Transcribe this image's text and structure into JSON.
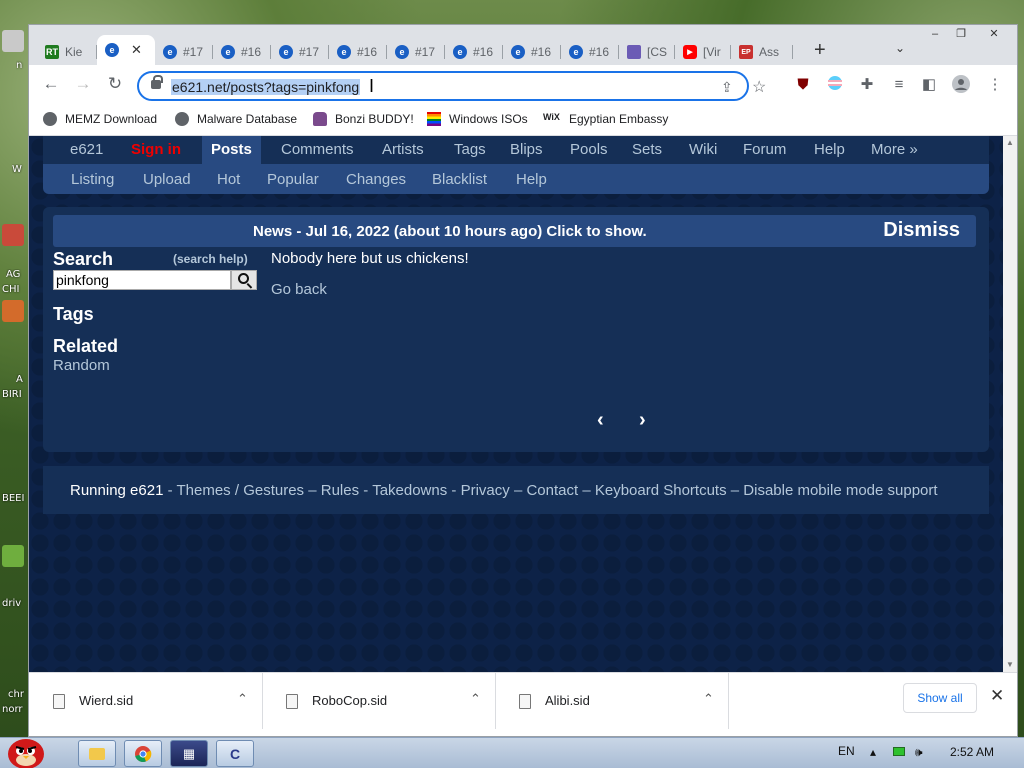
{
  "tabs": [
    {
      "label": "Kie",
      "favicon": "RT",
      "color": "#1f7a1f"
    },
    {
      "label": "",
      "favicon": "e",
      "color": "#1a5fc4",
      "active": true
    },
    {
      "label": "#17",
      "favicon": "e",
      "color": "#1a5fc4"
    },
    {
      "label": "#16",
      "favicon": "e",
      "color": "#1a5fc4"
    },
    {
      "label": "#17",
      "favicon": "e",
      "color": "#1a5fc4"
    },
    {
      "label": "#16",
      "favicon": "e",
      "color": "#1a5fc4"
    },
    {
      "label": "#17",
      "favicon": "e",
      "color": "#1a5fc4"
    },
    {
      "label": "#16",
      "favicon": "e",
      "color": "#1a5fc4"
    },
    {
      "label": "#16",
      "favicon": "e",
      "color": "#1a5fc4"
    },
    {
      "label": "#16",
      "favicon": "e",
      "color": "#1a5fc4"
    },
    {
      "label": "[CS",
      "favicon": "",
      "color": "#6b5bb5"
    },
    {
      "label": "[Vir",
      "favicon": "▶",
      "color": "#ff0000"
    },
    {
      "label": "Ass",
      "favicon": "EP",
      "color": "#c8302f"
    }
  ],
  "address_bar": {
    "url": "e621.net/posts?tags=pinkfong"
  },
  "bookmarks": [
    {
      "label": "MEMZ Download",
      "icon": "globe-icon"
    },
    {
      "label": "Malware Database",
      "icon": "globe-icon"
    },
    {
      "label": "Bonzi BUDDY!",
      "icon": "bonzi-icon"
    },
    {
      "label": "Windows ISOs",
      "icon": "windows-flag-icon"
    },
    {
      "label": "Egyptian Embassy",
      "icon": "wix-icon"
    }
  ],
  "site_nav": {
    "items": [
      "e621",
      "Sign in",
      "Posts",
      "Comments",
      "Artists",
      "Tags",
      "Blips",
      "Pools",
      "Sets",
      "Wiki",
      "Forum",
      "Help",
      "More »"
    ],
    "active": "Posts"
  },
  "sub_nav": {
    "items": [
      "Listing",
      "Upload",
      "Hot",
      "Popular",
      "Changes",
      "Blacklist",
      "Help"
    ]
  },
  "news": {
    "text": "News - Jul 16, 2022 (about 10 hours ago) Click to show.",
    "dismiss": "Dismiss"
  },
  "sidebar": {
    "search_title": "Search",
    "search_help": "(search help)",
    "search_value": "pinkfong",
    "tags_title": "Tags",
    "related_title": "Related",
    "related_link": "Random"
  },
  "results": {
    "empty_message": "Nobody here but us chickens!",
    "go_back": "Go back"
  },
  "pager": {
    "prev": "‹",
    "next": "›"
  },
  "footer": {
    "running": "Running e621",
    "links": [
      "Themes",
      "Gestures",
      "Rules",
      "Takedowns",
      "Privacy",
      "Contact",
      "Keyboard Shortcuts",
      "Disable mobile mode support"
    ]
  },
  "downloads": {
    "items": [
      "Wierd.sid",
      "RoboCop.sid",
      "Alibi.sid"
    ],
    "show_all": "Show all"
  },
  "taskbar": {
    "language": "EN",
    "time": "2:52 AM"
  },
  "desktop_labels": [
    "n",
    "W",
    "AG",
    "CHI",
    "A",
    "BIRI",
    "BEEI",
    "driv",
    "chr",
    "norr"
  ],
  "colors": {
    "accent": "#1a73e8",
    "site_bg": "#0b1e3d",
    "site_panel": "#152f56",
    "site_highlight": "#284a81",
    "link": "#b4c7d9",
    "signin": "#ee0000"
  }
}
